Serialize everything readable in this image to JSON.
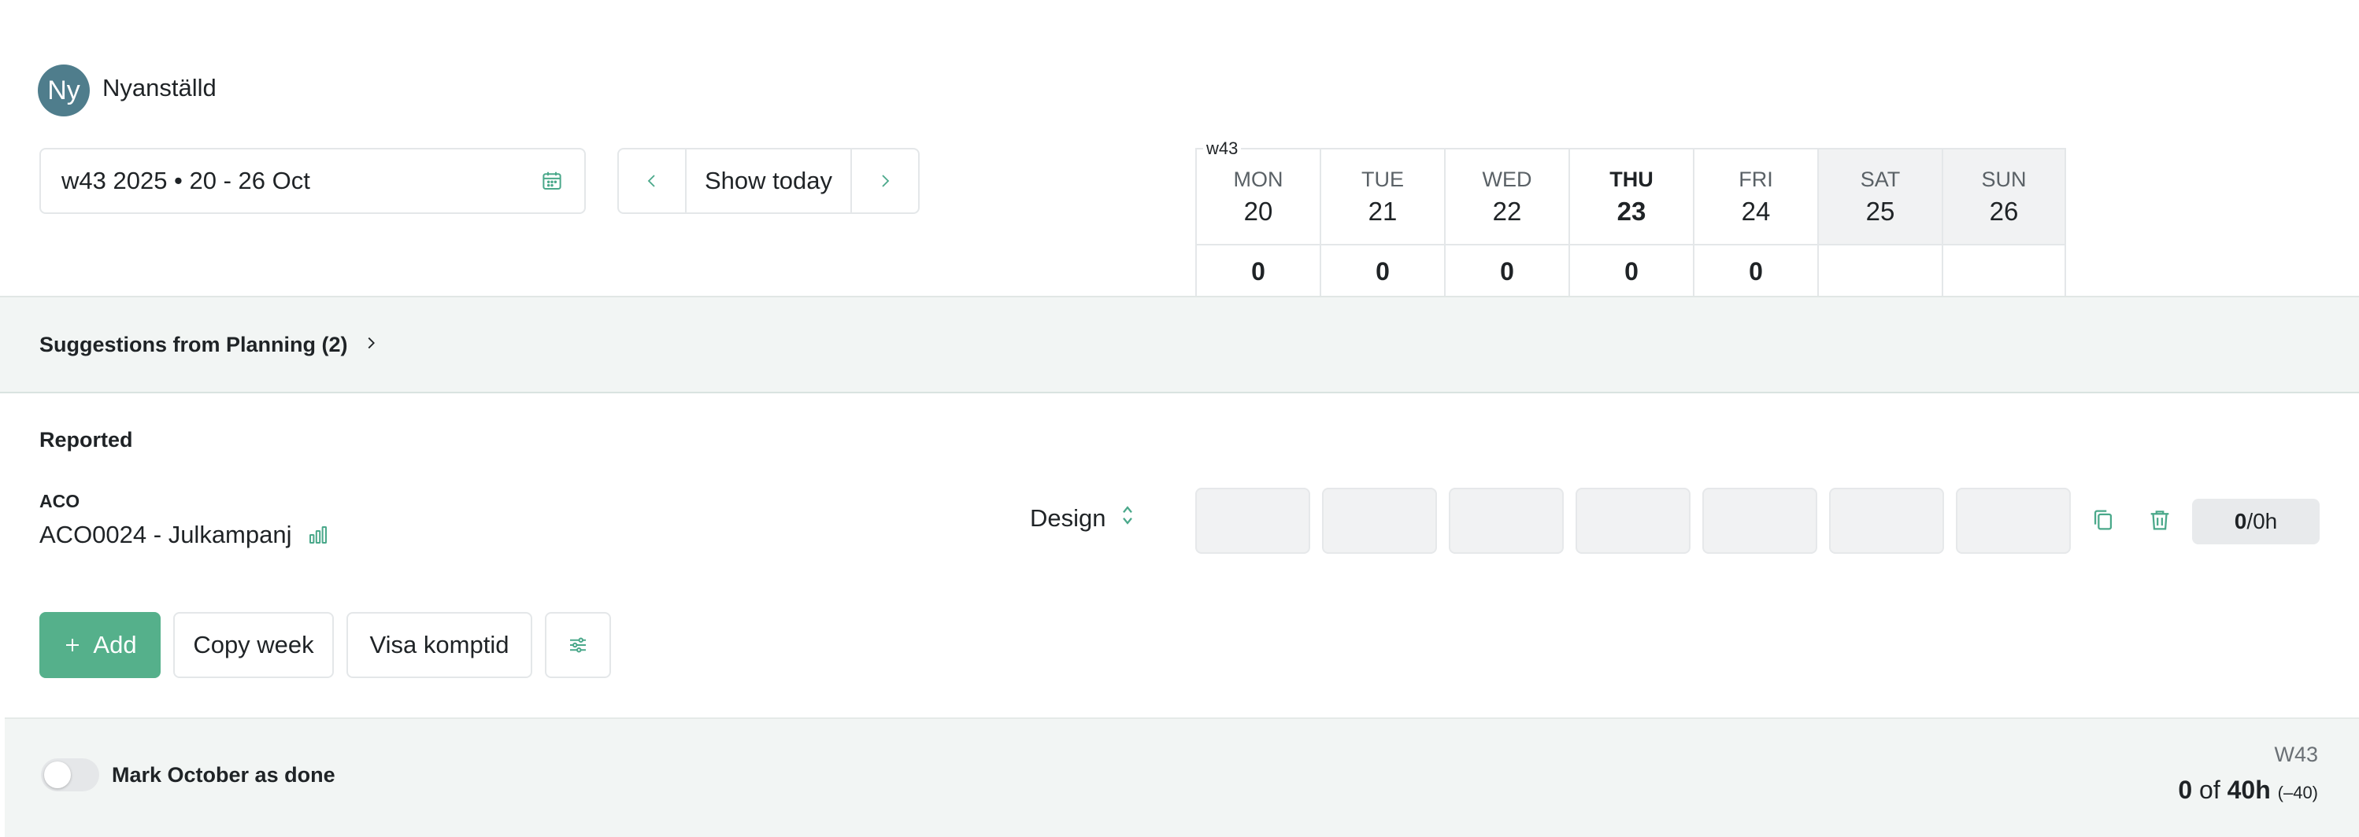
{
  "user": {
    "initials": "Ny",
    "name": "Nyanställd"
  },
  "week_picker": {
    "value": "w43 2025 • 20 - 26 Oct"
  },
  "nav": {
    "show_today": "Show today"
  },
  "week_header": {
    "label": "w43",
    "days": [
      {
        "name": "MON",
        "num": "20",
        "total": "0"
      },
      {
        "name": "TUE",
        "num": "21",
        "total": "0"
      },
      {
        "name": "WED",
        "num": "22",
        "total": "0"
      },
      {
        "name": "THU",
        "num": "23",
        "total": "0"
      },
      {
        "name": "FRI",
        "num": "24",
        "total": "0"
      },
      {
        "name": "SAT",
        "num": "25",
        "total": ""
      },
      {
        "name": "SUN",
        "num": "26",
        "total": ""
      }
    ]
  },
  "suggestions": {
    "label": "Suggestions from Planning (2)"
  },
  "reported": {
    "heading": "Reported"
  },
  "row": {
    "client": "ACO",
    "project": "ACO0024 - Julkampanj",
    "activity": "Design",
    "total_value": "0",
    "total_suffix": "/0h"
  },
  "actions": {
    "add": "Add",
    "copy_week": "Copy week",
    "visa_komptid": "Visa komptid"
  },
  "footer": {
    "mark_done": "Mark October as done",
    "week_label": "W43",
    "reported": "0",
    "of": "of",
    "target": "40h",
    "delta": "(–40)"
  },
  "colors": {
    "accent": "#55b08b",
    "avatar": "#4f7d8c",
    "band": "#f2f5f4"
  }
}
